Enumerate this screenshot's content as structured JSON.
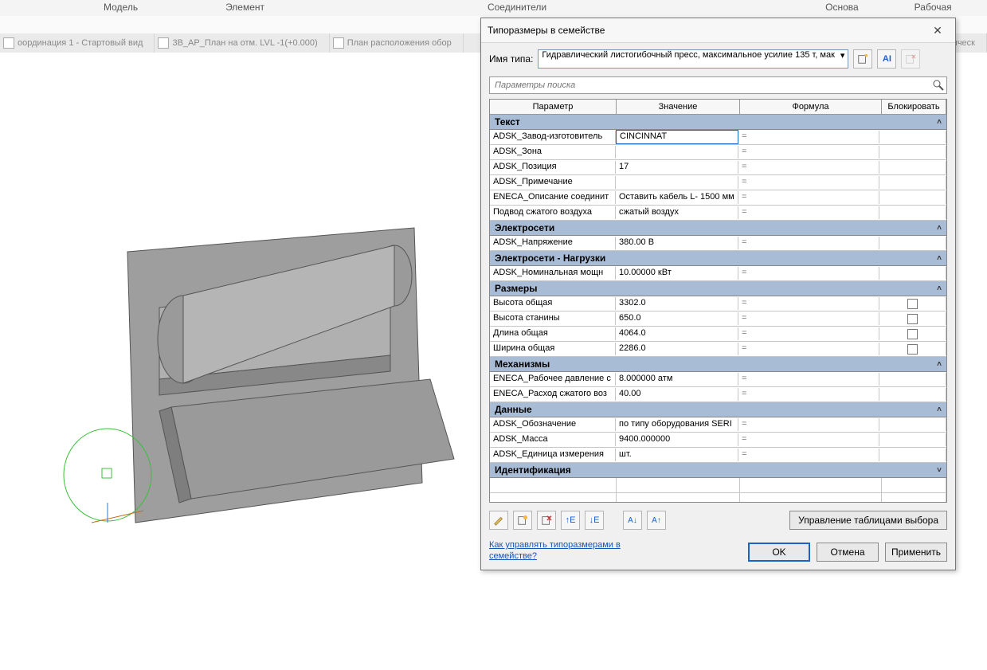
{
  "ribbon": {
    "t1": "Модель",
    "t2": "Элемент управления",
    "t3": "Соединители",
    "t4": "Основа",
    "t5": "Рабочая плоскость"
  },
  "views": {
    "v1": "оординация 1 - Стартовый вид",
    "v2": "3B_АР_План на отм. LVL -1(+0.000)",
    "v3": "План расположения обор",
    "v4": "влическ"
  },
  "dialog": {
    "title": "Типоразмеры в семействе",
    "typeLabel": "Имя типа:",
    "typeValue": "Гидравлический листогибочный пресс, максимальное усилие 135 т, мак",
    "searchPlaceholder": "Параметры поиска",
    "headers": {
      "p": "Параметр",
      "v": "Значение",
      "f": "Формула",
      "l": "Блокировать"
    },
    "manageBtn": "Управление таблицами выбора",
    "help": "Как управлять типоразмерами в семействе?",
    "ok": "OK",
    "cancel": "Отмена",
    "apply": "Применить"
  },
  "groups": [
    {
      "title": "Текст",
      "rows": [
        {
          "p": "ADSK_Завод-изготовитель",
          "v": "CINCINNAT",
          "f": "=",
          "editing": true
        },
        {
          "p": "ADSK_Зона",
          "v": "",
          "f": "="
        },
        {
          "p": "ADSK_Позиция",
          "v": "17",
          "f": "="
        },
        {
          "p": "ADSK_Примечание",
          "v": "",
          "f": "="
        },
        {
          "p": "ENECA_Описание соединит",
          "v": "Оставить кабель L- 1500 мм",
          "f": "="
        },
        {
          "p": "Подвод сжатого воздуха",
          "v": "сжатый воздух",
          "f": "="
        }
      ]
    },
    {
      "title": "Электросети",
      "rows": [
        {
          "p": "ADSK_Напряжение",
          "v": "380.00 В",
          "f": "="
        }
      ]
    },
    {
      "title": "Электросети - Нагрузки",
      "rows": [
        {
          "p": "ADSK_Номинальная мощн",
          "v": "10.00000 кВт",
          "f": "="
        }
      ]
    },
    {
      "title": "Размеры",
      "rows": [
        {
          "p": "Высота общая",
          "v": "3302.0",
          "f": "=",
          "lock": true
        },
        {
          "p": "Высота станины",
          "v": "650.0",
          "f": "=",
          "lock": true
        },
        {
          "p": "Длина общая",
          "v": "4064.0",
          "f": "=",
          "lock": true
        },
        {
          "p": "Ширина общая",
          "v": "2286.0",
          "f": "=",
          "lock": true
        }
      ]
    },
    {
      "title": "Механизмы",
      "rows": [
        {
          "p": "ENECA_Рабочее давление с",
          "v": "8.000000 атм",
          "f": "="
        },
        {
          "p": "ENECA_Расход сжатого воз",
          "v": "40.00",
          "f": "="
        }
      ]
    },
    {
      "title": "Данные",
      "rows": [
        {
          "p": "ADSK_Обозначение",
          "v": "по типу оборудования SERI",
          "f": "="
        },
        {
          "p": "ADSK_Масса",
          "v": "9400.000000",
          "f": "="
        },
        {
          "p": "ADSK_Единица измерения",
          "v": "шт.",
          "f": "="
        }
      ]
    },
    {
      "title": "Идентификация",
      "collapsed": true,
      "rows": []
    }
  ]
}
